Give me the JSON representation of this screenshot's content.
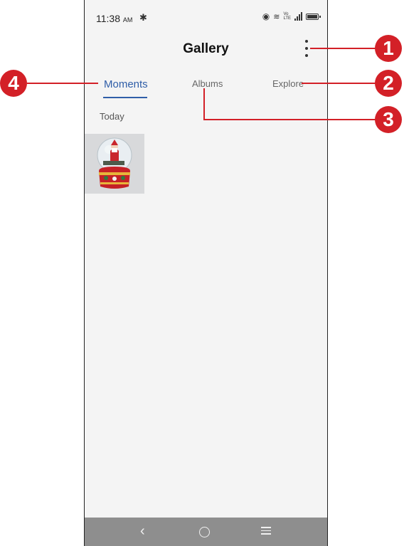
{
  "status_bar": {
    "time": "11:38",
    "ampm": "AM",
    "volte_top": "Vo",
    "volte_bottom": "LTE"
  },
  "header": {
    "title": "Gallery"
  },
  "tabs": [
    {
      "label": "Moments",
      "selected": true
    },
    {
      "label": "Albums",
      "selected": false
    },
    {
      "label": "Explore",
      "selected": false
    }
  ],
  "content": {
    "section_label": "Today",
    "items": [
      {
        "type": "photo",
        "description": "snow-globe-santa"
      }
    ]
  },
  "callouts": [
    {
      "number": "1"
    },
    {
      "number": "2"
    },
    {
      "number": "3"
    },
    {
      "number": "4"
    }
  ],
  "colors": {
    "accent": "#2f5ea8",
    "callout": "#d32027",
    "nav_bar": "#8e8e8e"
  }
}
